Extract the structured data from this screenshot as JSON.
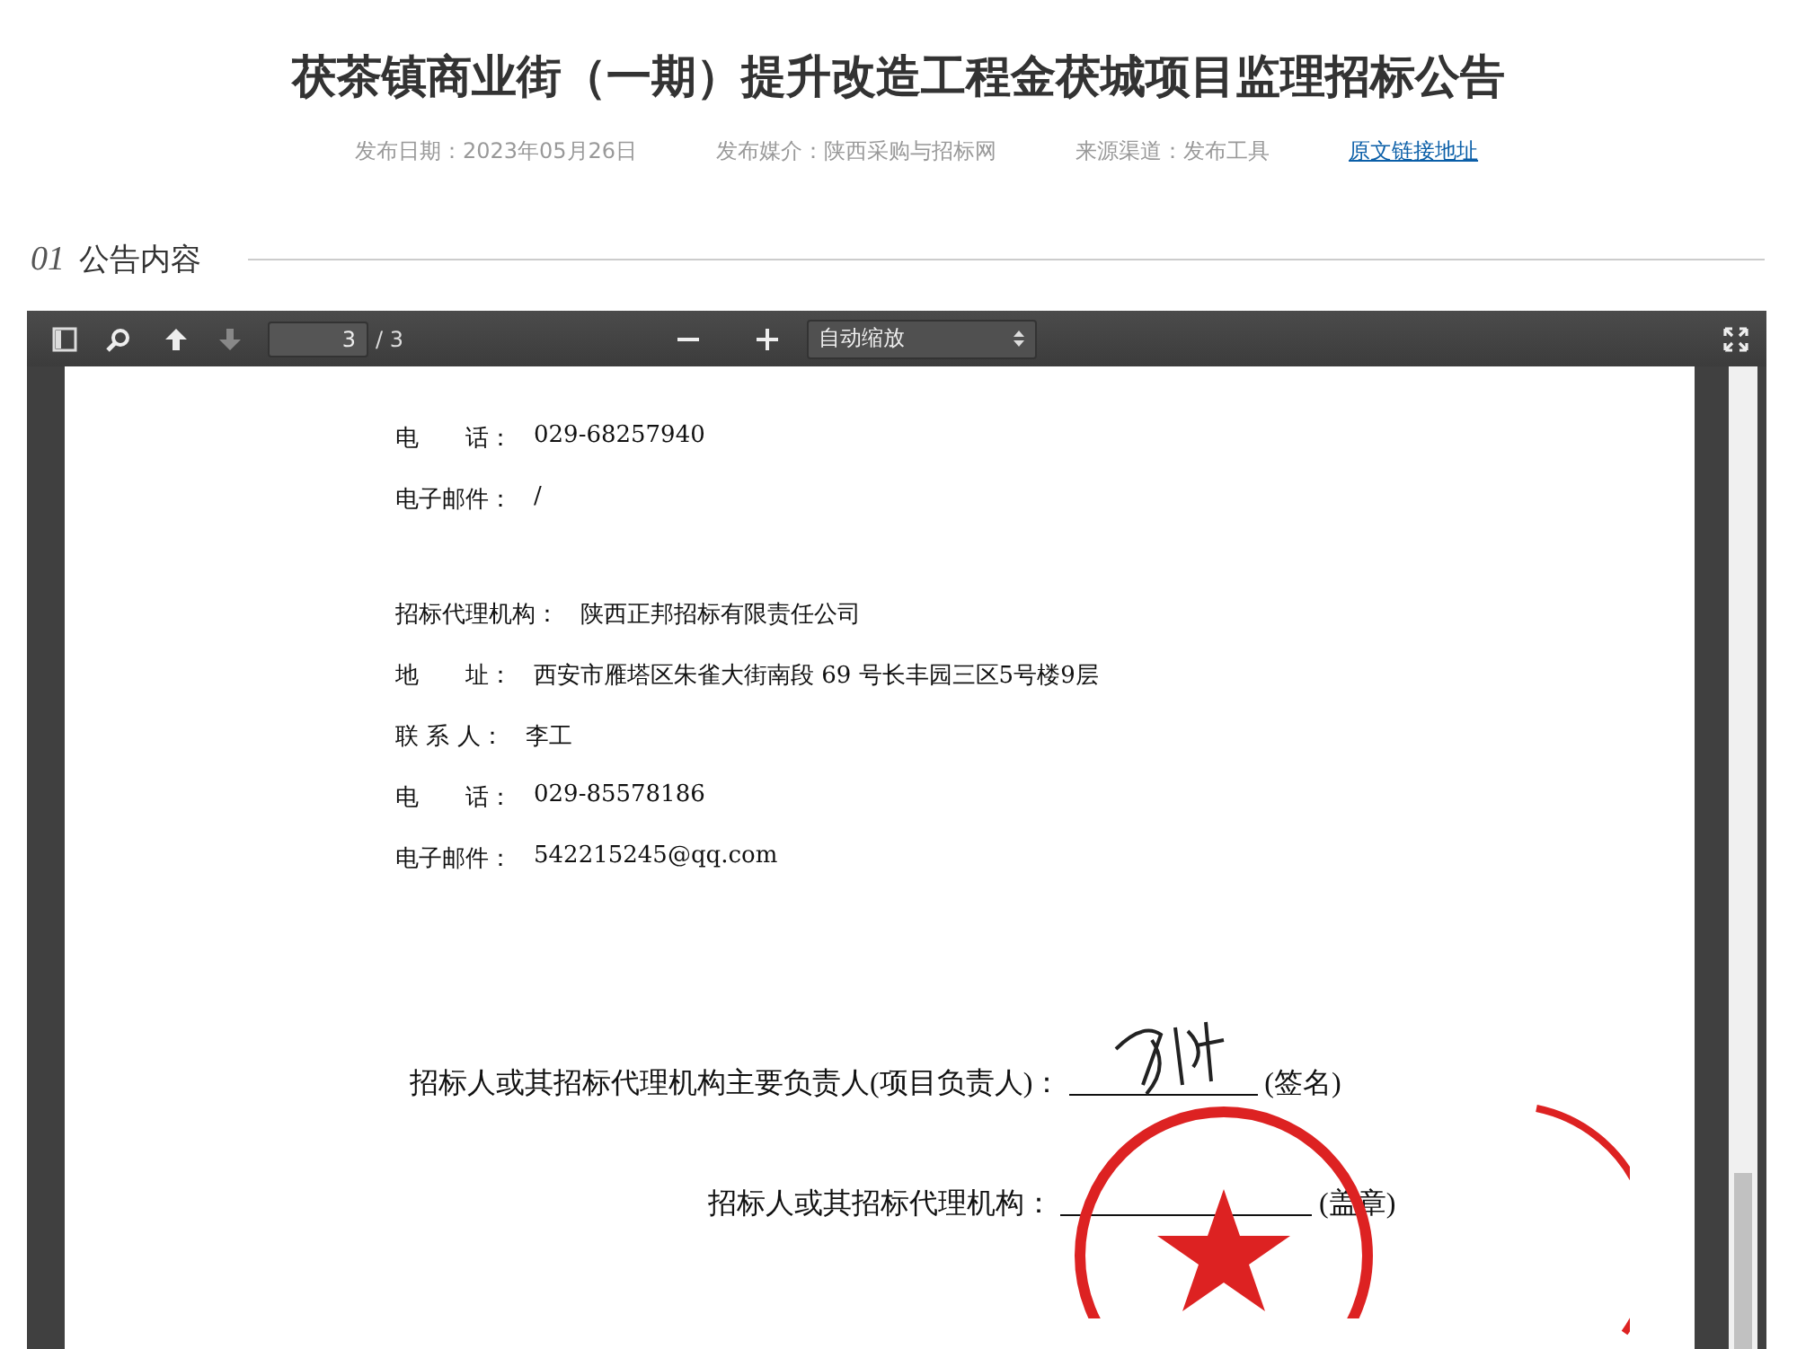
{
  "title": "茯茶镇商业街（一期）提升改造工程金茯城项目监理招标公告",
  "meta": [
    {
      "text": "发布日期：2023年05月26日",
      "kind": "text"
    },
    {
      "text": "发布媒介：陕西采购与招标网",
      "kind": "text"
    },
    {
      "text": "来源渠道：发布工具",
      "kind": "text"
    },
    {
      "text": "原文链接地址",
      "kind": "link"
    }
  ],
  "section": {
    "number": "01",
    "title": "公告内容"
  },
  "viewer": {
    "page": "3",
    "total": "/ 3",
    "zoom": "自动缩放"
  },
  "document": {
    "groups": [
      [
        {
          "label": "电　　话：",
          "value": "029-68257940"
        },
        {
          "label": "电子邮件：",
          "value": "/"
        }
      ],
      [
        {
          "label": "招标代理机构：",
          "value": "陕西正邦招标有限责任公司"
        },
        {
          "label": "地　　址：",
          "value": "西安市雁塔区朱雀大街南段 69 号长丰园三区5号楼9层"
        },
        {
          "label": "联 系 人：",
          "value": "李工"
        },
        {
          "label": "电　　话：",
          "value": "029-85578186"
        },
        {
          "label": "电子邮件：",
          "value": "542215245@qq.com"
        }
      ]
    ],
    "signatures": [
      {
        "label": "招标人或其招标代理机构主要负责人(项目负责人)：",
        "note": "(签名)"
      },
      {
        "label": "招标人或其招标代理机构：",
        "note": "(盖章)"
      }
    ]
  }
}
